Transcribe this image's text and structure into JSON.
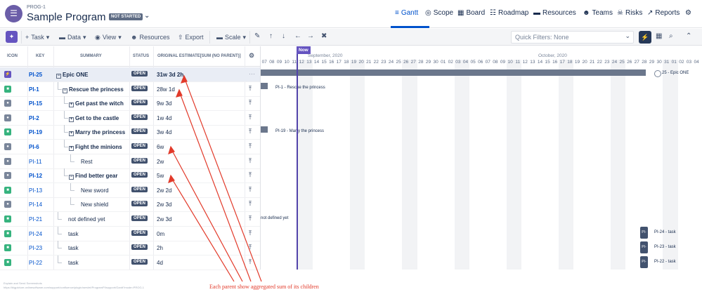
{
  "header": {
    "logo_glyph": "☰",
    "project_key": "PROG-1",
    "project_title": "Sample Program PI",
    "status_badge": "NOT STARTED",
    "chevron": "⌄"
  },
  "nav": [
    {
      "icon": "≡",
      "label": "Gantt"
    },
    {
      "icon": "◎",
      "label": "Scope"
    },
    {
      "icon": "▦",
      "label": "Board"
    },
    {
      "icon": "☷",
      "label": "Roadmap"
    },
    {
      "icon": "▬",
      "label": "Resources"
    },
    {
      "icon": "☻",
      "label": "Teams"
    },
    {
      "icon": "☠",
      "label": "Risks"
    },
    {
      "icon": "↗",
      "label": "Reports"
    },
    {
      "icon": "⚙",
      "label": ""
    }
  ],
  "toolbar": {
    "task": "Task",
    "data": "Data",
    "view": "View",
    "resources": "Resources",
    "export": "Export",
    "scale": "Scale",
    "quick_filters": "Quick Filters: None",
    "plus": "+",
    "caret": "▾",
    "person_icon": "☻",
    "export_icon": "⇧",
    "scale_icon": "▬",
    "magic_icon": "✦"
  },
  "toolbar_icons": {
    "edit": "✎",
    "up": "↑",
    "down": "↓",
    "left": "←",
    "right": "→",
    "delete": "✖",
    "bolt": "⚡",
    "calendar": "▦",
    "search": "⌕",
    "collapse": "⌃"
  },
  "columns": {
    "icon": "ICON",
    "key": "KEY",
    "summary": "SUMMARY",
    "status": "STATUS",
    "estimate": "ORIGINAL ESTIMATE[SUM (NO PARENT)]",
    "settings_glyph": "⚙"
  },
  "rows": [
    {
      "type": "epic",
      "key": "PI-25",
      "summary": "Epic ONE",
      "status": "OPEN",
      "estimate": "31w 3d 2h",
      "bold": true,
      "expander": "−"
    },
    {
      "type": "story",
      "key": "PI-1",
      "summary": "Rescue the princess",
      "status": "OPEN",
      "estimate": "28w 1d",
      "bold": true,
      "expander": "−"
    },
    {
      "type": "task",
      "key": "PI-15",
      "summary": "Get past the witch",
      "status": "OPEN",
      "estimate": "9w 3d",
      "bold": true,
      "expander": "+"
    },
    {
      "type": "task",
      "key": "PI-2",
      "summary": "Get to the castle",
      "status": "OPEN",
      "estimate": "1w 4d",
      "bold": true,
      "expander": "+"
    },
    {
      "type": "story",
      "key": "PI-19",
      "summary": "Marry the princess",
      "status": "OPEN",
      "estimate": "3w 4d",
      "bold": true,
      "expander": "+"
    },
    {
      "type": "task",
      "key": "PI-6",
      "summary": "Fight the minions",
      "status": "OPEN",
      "estimate": "6w",
      "bold": true,
      "expander": "+"
    },
    {
      "type": "task",
      "key": "PI-11",
      "summary": "Rest",
      "status": "OPEN",
      "estimate": "2w",
      "bold": false,
      "expander": ""
    },
    {
      "type": "task",
      "key": "PI-12",
      "summary": "Find better gear",
      "status": "OPEN",
      "estimate": "5w",
      "bold": true,
      "expander": "−"
    },
    {
      "type": "story",
      "key": "PI-13",
      "summary": "New sword",
      "status": "OPEN",
      "estimate": "2w 2d",
      "bold": false,
      "expander": ""
    },
    {
      "type": "task",
      "key": "PI-14",
      "summary": "New shield",
      "status": "OPEN",
      "estimate": "2w 3d",
      "bold": false,
      "expander": ""
    },
    {
      "type": "story",
      "key": "PI-21",
      "summary": "not defined yet",
      "status": "OPEN",
      "estimate": "2w 3d",
      "bold": false,
      "expander": ""
    },
    {
      "type": "story",
      "key": "PI-24",
      "summary": "task",
      "status": "OPEN",
      "estimate": "0m",
      "bold": false,
      "expander": ""
    },
    {
      "type": "story",
      "key": "PI-23",
      "summary": "task",
      "status": "OPEN",
      "estimate": "2h",
      "bold": false,
      "expander": ""
    },
    {
      "type": "story",
      "key": "PI-22",
      "summary": "task",
      "status": "OPEN",
      "estimate": "4d",
      "bold": false,
      "expander": ""
    }
  ],
  "gantt": {
    "now_label": "Now",
    "months": [
      "September, 2020",
      "October, 2020"
    ],
    "days": [
      "07",
      "08",
      "09",
      "10",
      "11",
      "12",
      "13",
      "14",
      "15",
      "16",
      "17",
      "18",
      "19",
      "20",
      "21",
      "22",
      "23",
      "24",
      "25",
      "26",
      "27",
      "28",
      "29",
      "30",
      "01",
      "02",
      "03",
      "04",
      "05",
      "06",
      "07",
      "08",
      "09",
      "10",
      "11",
      "12",
      "13",
      "14",
      "15",
      "16",
      "17",
      "18",
      "19",
      "20",
      "21",
      "22",
      "23",
      "24",
      "25",
      "26",
      "27",
      "28",
      "29",
      "30",
      "31",
      "01",
      "02",
      "03",
      "04"
    ],
    "labels": {
      "epic": "25 - Epic ONE",
      "pi1": "PI-1 - Rescue the princess",
      "pi19": "PI-19 - Marry the princess",
      "pi21": "not defined yet",
      "pi24": "PI-24 - task",
      "pi23": "PI-23 - task",
      "pi22": "PI-22 - task",
      "tbar": "PI-"
    },
    "row_menu_glyph": "⋯",
    "pin_glyph": "⤒"
  },
  "annotation": "Each parent show aggregated sum of its children",
  "footer": {
    "line1": "Explain and Send Screenshots",
    "line2": "https://bigpicture.onlinesoftware.com/support/confluence/plugin/servlet/ProgramPI/support/Gantt?mode=PROG-1"
  }
}
